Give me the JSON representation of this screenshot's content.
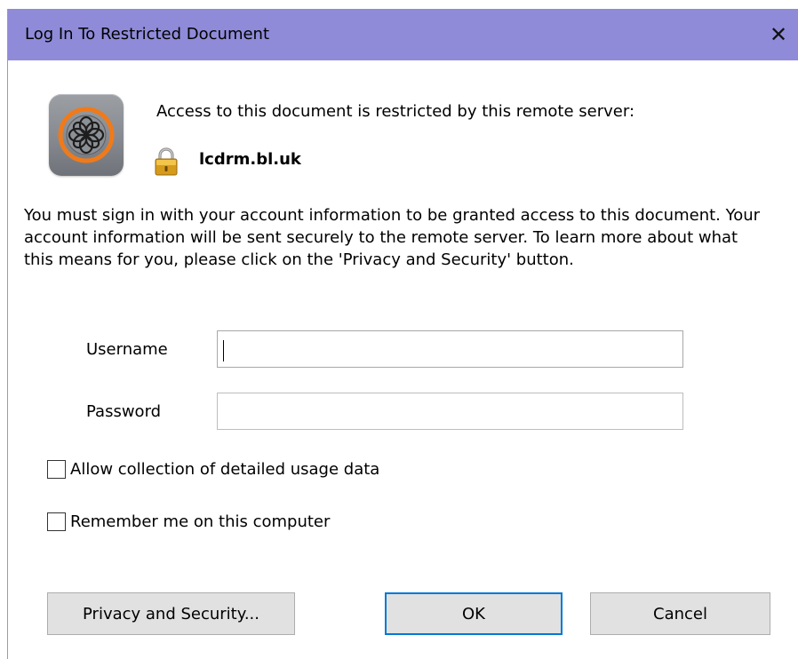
{
  "window": {
    "title": "Log In To Restricted Document",
    "close_glyph": "✕"
  },
  "header": {
    "icon": "adobe-drm-icon",
    "message": "Access to this document is restricted by this remote server:",
    "lock_icon": "lock-icon",
    "server": "lcdrm.bl.uk"
  },
  "body": {
    "message": "You must sign in with your account information to be granted access to this document. Your account information will be sent securely to the remote server. To learn more about what this means for you, please click on the 'Privacy and Security' button."
  },
  "form": {
    "username": {
      "label": "Username",
      "value": ""
    },
    "password": {
      "label": "Password",
      "value": ""
    }
  },
  "options": {
    "usage_data": {
      "label": "Allow collection of detailed usage data",
      "checked": false
    },
    "remember_me": {
      "label": "Remember me on this computer",
      "checked": false
    }
  },
  "buttons": {
    "privacy": "Privacy and Security...",
    "ok": "OK",
    "cancel": "Cancel"
  },
  "colors": {
    "titlebar": "#8f8bd9",
    "default_button_border": "#0078d7",
    "icon_ring": "#f07a1a"
  }
}
